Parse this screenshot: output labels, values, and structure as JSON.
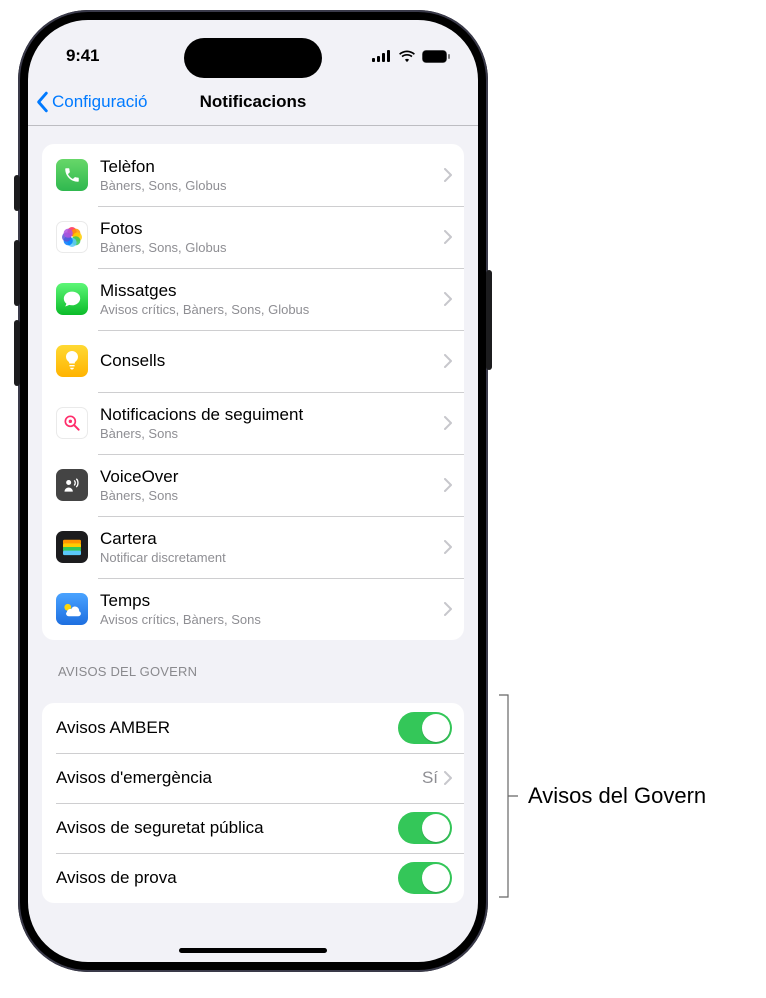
{
  "status": {
    "time": "9:41"
  },
  "nav": {
    "back": "Configuració",
    "title": "Notificacions"
  },
  "apps": [
    {
      "key": "phone",
      "title": "Telèfon",
      "sub": "Bàners, Sons, Globus"
    },
    {
      "key": "photos",
      "title": "Fotos",
      "sub": "Bàners, Sons, Globus"
    },
    {
      "key": "messages",
      "title": "Missatges",
      "sub": "Avisos crítics, Bàners, Sons, Globus"
    },
    {
      "key": "tips",
      "title": "Consells",
      "sub": ""
    },
    {
      "key": "tracking",
      "title": "Notificacions de seguiment",
      "sub": "Bàners, Sons"
    },
    {
      "key": "voiceover",
      "title": "VoiceOver",
      "sub": "Bàners, Sons"
    },
    {
      "key": "wallet",
      "title": "Cartera",
      "sub": "Notificar discretament"
    },
    {
      "key": "weather",
      "title": "Temps",
      "sub": "Avisos crítics, Bàners, Sons"
    }
  ],
  "gov": {
    "header": "Avisos del Govern",
    "amber": {
      "label": "Avisos AMBER",
      "on": true
    },
    "emergency": {
      "label": "Avisos d'emergència",
      "value": "Sí"
    },
    "public": {
      "label": "Avisos de seguretat pública",
      "on": true
    },
    "test": {
      "label": "Avisos de prova",
      "on": true
    }
  },
  "callout": {
    "label": "Avisos del Govern"
  }
}
